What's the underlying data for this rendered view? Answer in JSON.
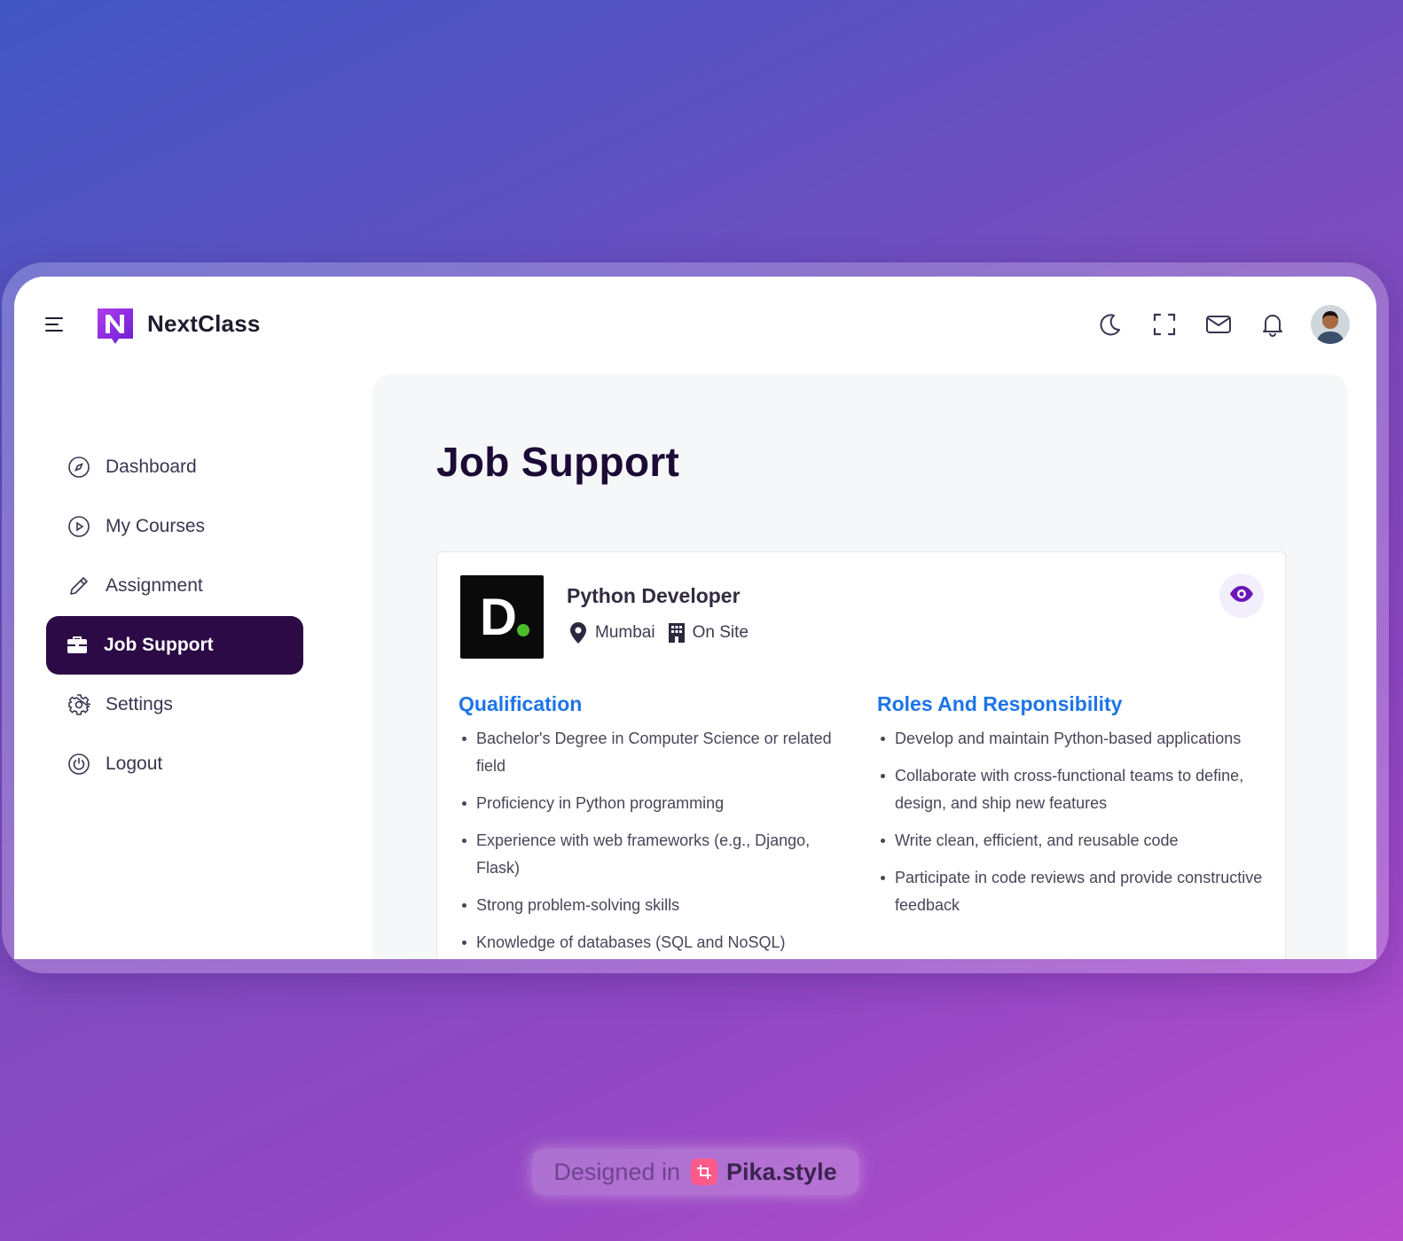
{
  "app": {
    "brand": "NextClass",
    "logo_letter": "N"
  },
  "topbar": {
    "icons": [
      "moon-icon",
      "fullscreen-icon",
      "mail-icon",
      "bell-icon"
    ],
    "avatar": "user-avatar"
  },
  "sidebar": {
    "items": [
      {
        "label": "Dashboard",
        "icon": "compass-icon",
        "active": false
      },
      {
        "label": "My Courses",
        "icon": "play-circle-icon",
        "active": false
      },
      {
        "label": "Assignment",
        "icon": "pencil-icon",
        "active": false
      },
      {
        "label": "Job Support",
        "icon": "briefcase-icon",
        "active": true
      },
      {
        "label": "Settings",
        "icon": "gear-icon",
        "active": false
      },
      {
        "label": "Logout",
        "icon": "power-icon",
        "active": false
      }
    ]
  },
  "main": {
    "title": "Job Support",
    "job": {
      "company_logo_letter": "D.",
      "title": "Python Developer",
      "location": "Mumbai",
      "work_type": "On Site",
      "qualification_heading": "Qualification",
      "qualifications": [
        "Bachelor's Degree in Computer Science or related field",
        "Proficiency in Python programming",
        "Experience with web frameworks (e.g., Django, Flask)",
        "Strong problem-solving skills",
        "Knowledge of databases (SQL and NoSQL)"
      ],
      "roles_heading": "Roles And Responsibility",
      "roles": [
        "Develop and maintain Python-based applications",
        "Collaborate with cross-functional teams to define, design, and ship new features",
        "Write clean, efficient, and reusable code",
        "Participate in code reviews and provide constructive feedback"
      ]
    }
  },
  "watermark": {
    "prefix": "Designed in",
    "brand": "Pika.style"
  },
  "colors": {
    "active_nav": "#2b0a45",
    "accent_blue": "#1d74e8",
    "logo_purple": "#8a2be2",
    "title_dark": "#1c0b35"
  }
}
